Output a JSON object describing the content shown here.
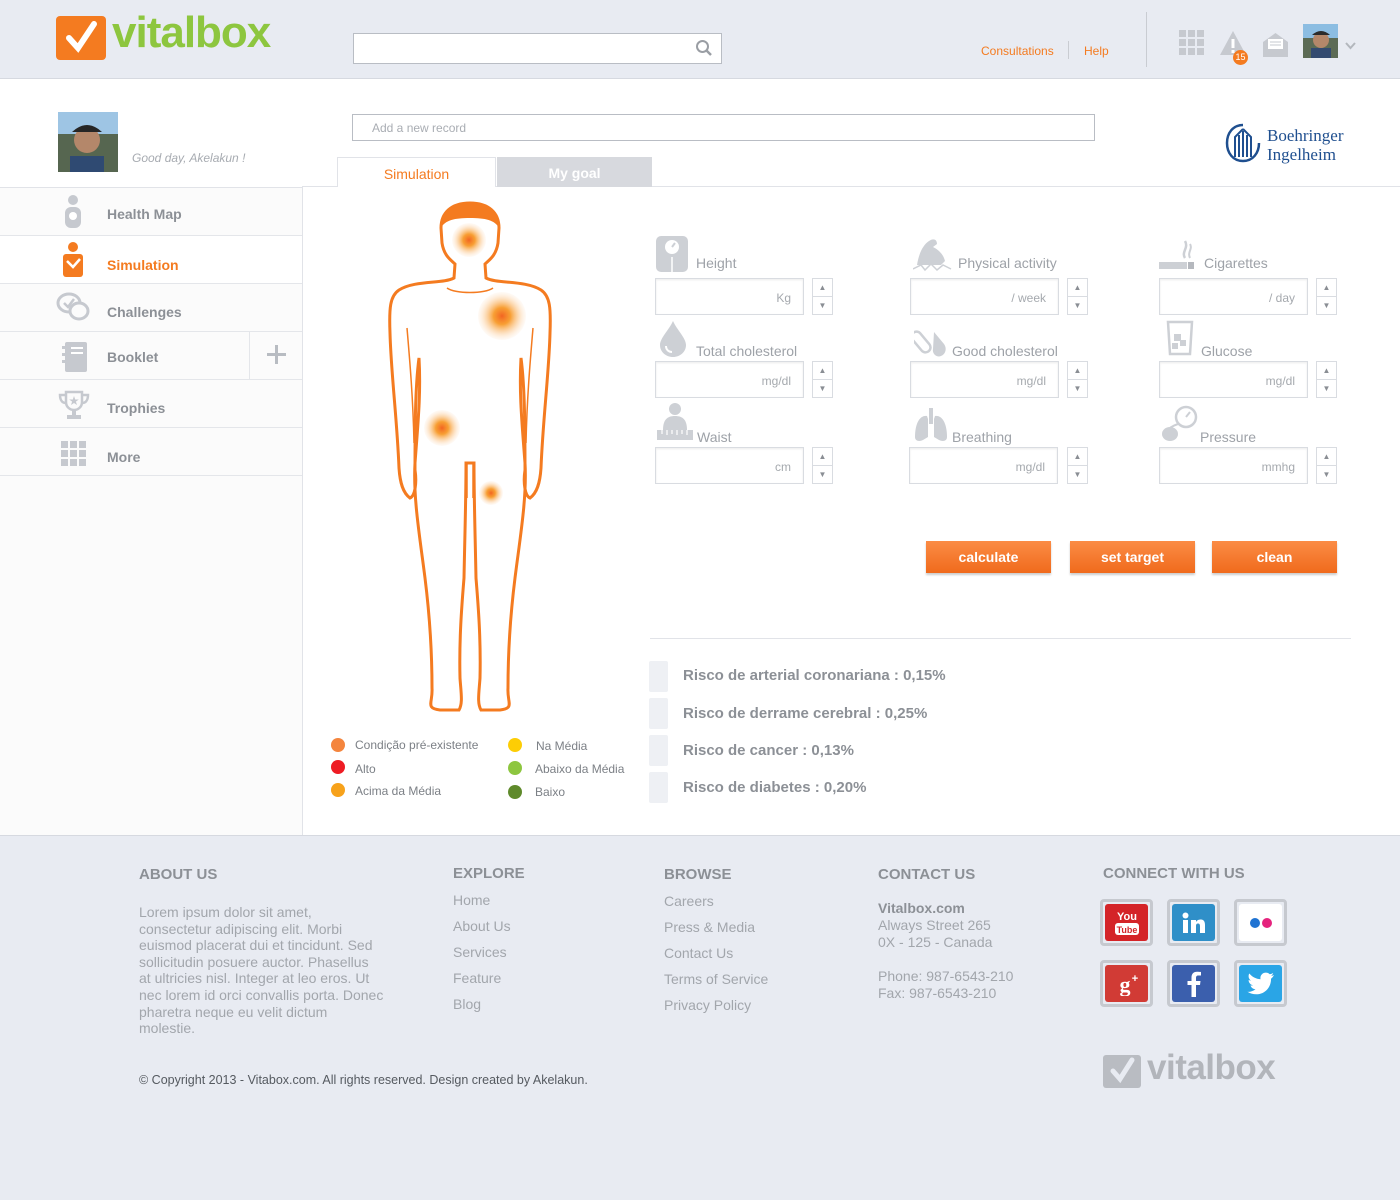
{
  "header": {
    "brand": "vitalbox",
    "search_placeholder": "",
    "nav": {
      "consultations": "Consultations",
      "help": "Help"
    },
    "notification_count": "15",
    "icons": [
      "apps-grid-icon",
      "alert-icon",
      "messages-icon",
      "chevron-down-icon"
    ]
  },
  "profile": {
    "greeting": "Good day, Akelakun !",
    "add_record_placeholder": "Add a new record",
    "partner": {
      "line1": "Boehringer",
      "line2": "Ingelheim"
    }
  },
  "tabs": [
    {
      "label": "Simulation",
      "active": true
    },
    {
      "label": "My goal",
      "active": false
    }
  ],
  "sidebar": {
    "items": [
      {
        "label": "Health Map",
        "icon": "health-map-icon"
      },
      {
        "label": "Simulation",
        "icon": "simulation-icon",
        "active": true
      },
      {
        "label": "Challenges",
        "icon": "challenges-icon"
      },
      {
        "label": "Booklet",
        "icon": "booklet-icon",
        "action": "+"
      },
      {
        "label": "Trophies",
        "icon": "trophy-icon"
      },
      {
        "label": "More",
        "icon": "more-grid-icon"
      }
    ]
  },
  "legend": [
    {
      "label": "Condição pré-existente",
      "color": "#f4853e"
    },
    {
      "label": "Alto",
      "color": "#ee1c24"
    },
    {
      "label": "Acima da Média",
      "color": "#f7a21b"
    },
    {
      "label": "Na Média",
      "color": "#fdcd05"
    },
    {
      "label": "Abaixo da Média",
      "color": "#8dc63f"
    },
    {
      "label": "Baixo",
      "color": "#5f8a2b"
    }
  ],
  "fields": [
    {
      "label": "Height",
      "unit": "Kg",
      "icon": "scale-icon"
    },
    {
      "label": "Physical activity",
      "unit": "/ week",
      "icon": "arm-muscle-icon"
    },
    {
      "label": "Cigarettes",
      "unit": "/ day",
      "icon": "cigarette-icon"
    },
    {
      "label": "Total cholesterol",
      "unit": "mg/dl",
      "icon": "blood-drop-icon"
    },
    {
      "label": "Good cholesterol",
      "unit": "mg/dl",
      "icon": "test-tube-icon"
    },
    {
      "label": "Glucose",
      "unit": "mg/dl",
      "icon": "glucose-glass-icon"
    },
    {
      "label": "Waist",
      "unit": "cm",
      "icon": "waist-measure-icon"
    },
    {
      "label": "Breathing",
      "unit": "mg/dl",
      "icon": "lungs-icon"
    },
    {
      "label": "Pressure",
      "unit": "mmhg",
      "icon": "pressure-gauge-icon"
    }
  ],
  "buttons": {
    "calculate": "calculate",
    "set_target": "set target",
    "clean": "clean"
  },
  "results": [
    "Risco de arterial coronariana : 0,15%",
    "Risco de derrame cerebral : 0,25%",
    "Risco de cancer : 0,13%",
    "Risco de diabetes : 0,20%"
  ],
  "footer": {
    "about": {
      "title": "ABOUT US",
      "text": "Lorem ipsum dolor sit amet, consectetur adipiscing elit. Morbi euismod placerat dui et tincidunt. Sed sollicitudin posuere auctor. Phasellus at ultricies nisl. Integer at leo eros. Ut nec lorem id orci convallis porta. Donec pharetra neque eu velit dictum molestie."
    },
    "explore": {
      "title": "EXPLORE",
      "links": [
        "Home",
        "About Us",
        "Services",
        "Feature",
        "Blog"
      ]
    },
    "browse": {
      "title": "BROWSE",
      "links": [
        "Careers",
        "Press & Media",
        "Contact Us",
        "Terms of Service",
        "Privacy Policy"
      ]
    },
    "contact": {
      "title": "CONTACT US",
      "site": "Vitalbox.com",
      "street": "Always Street 265",
      "city": "0X - 125 - Canada",
      "phone": "Phone: 987-6543-210",
      "fax": "Fax: 987-6543-210"
    },
    "connect": {
      "title": "CONNECT WITH US",
      "networks": [
        "youtube-icon",
        "linkedin-icon",
        "flickr-icon",
        "google-plus-icon",
        "facebook-icon",
        "twitter-icon"
      ]
    },
    "copyright": "© Copyright 2013 - Vitabox.com. All rights reserved. Design created by Akelakun.",
    "brand": "vitalbox"
  }
}
